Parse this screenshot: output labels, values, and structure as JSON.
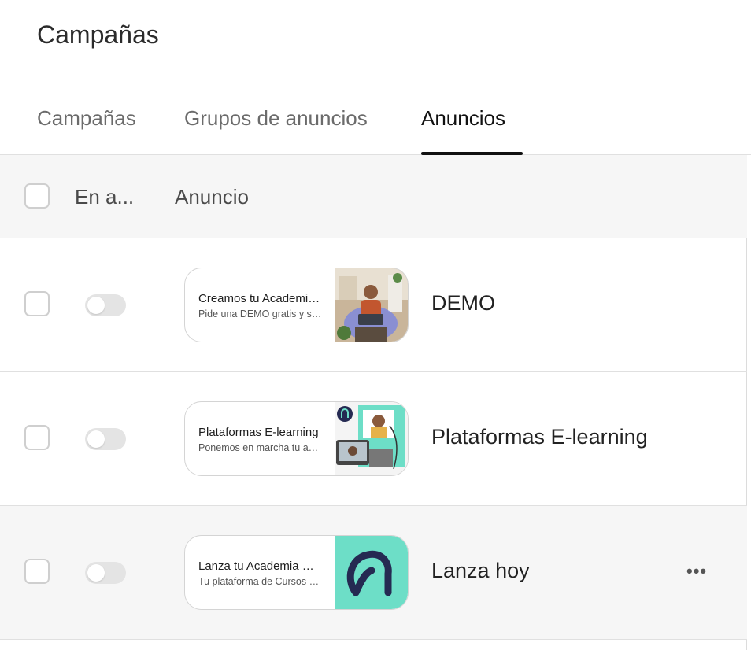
{
  "page": {
    "title": "Campañas"
  },
  "tabs": [
    {
      "label": "Campañas"
    },
    {
      "label": "Grupos de anuncios"
    },
    {
      "label": "Anuncios"
    }
  ],
  "table": {
    "headers": {
      "status": "En a...",
      "ad": "Anuncio"
    },
    "rows": [
      {
        "headline": "Creamos tu Academia Online",
        "description": "Pide una DEMO gratis y sin compromiso",
        "name": "DEMO",
        "enabled": false,
        "thumb_icon": "woman-with-laptop-photo"
      },
      {
        "headline": "Plataformas E-learning",
        "description": "Ponemos en marcha tu academia",
        "name": "Plataformas E-learning",
        "enabled": false,
        "thumb_icon": "video-call-illustration"
      },
      {
        "headline": "Lanza tu Academia Online",
        "description": "Tu plataforma de Cursos Online",
        "name": "Lanza hoy",
        "enabled": false,
        "thumb_icon": "brand-logo",
        "more_label": "•••"
      }
    ]
  },
  "colors": {
    "brand_teal": "#6ddec7",
    "brand_navy": "#252a52",
    "hover_row": "#f6f6f6"
  }
}
